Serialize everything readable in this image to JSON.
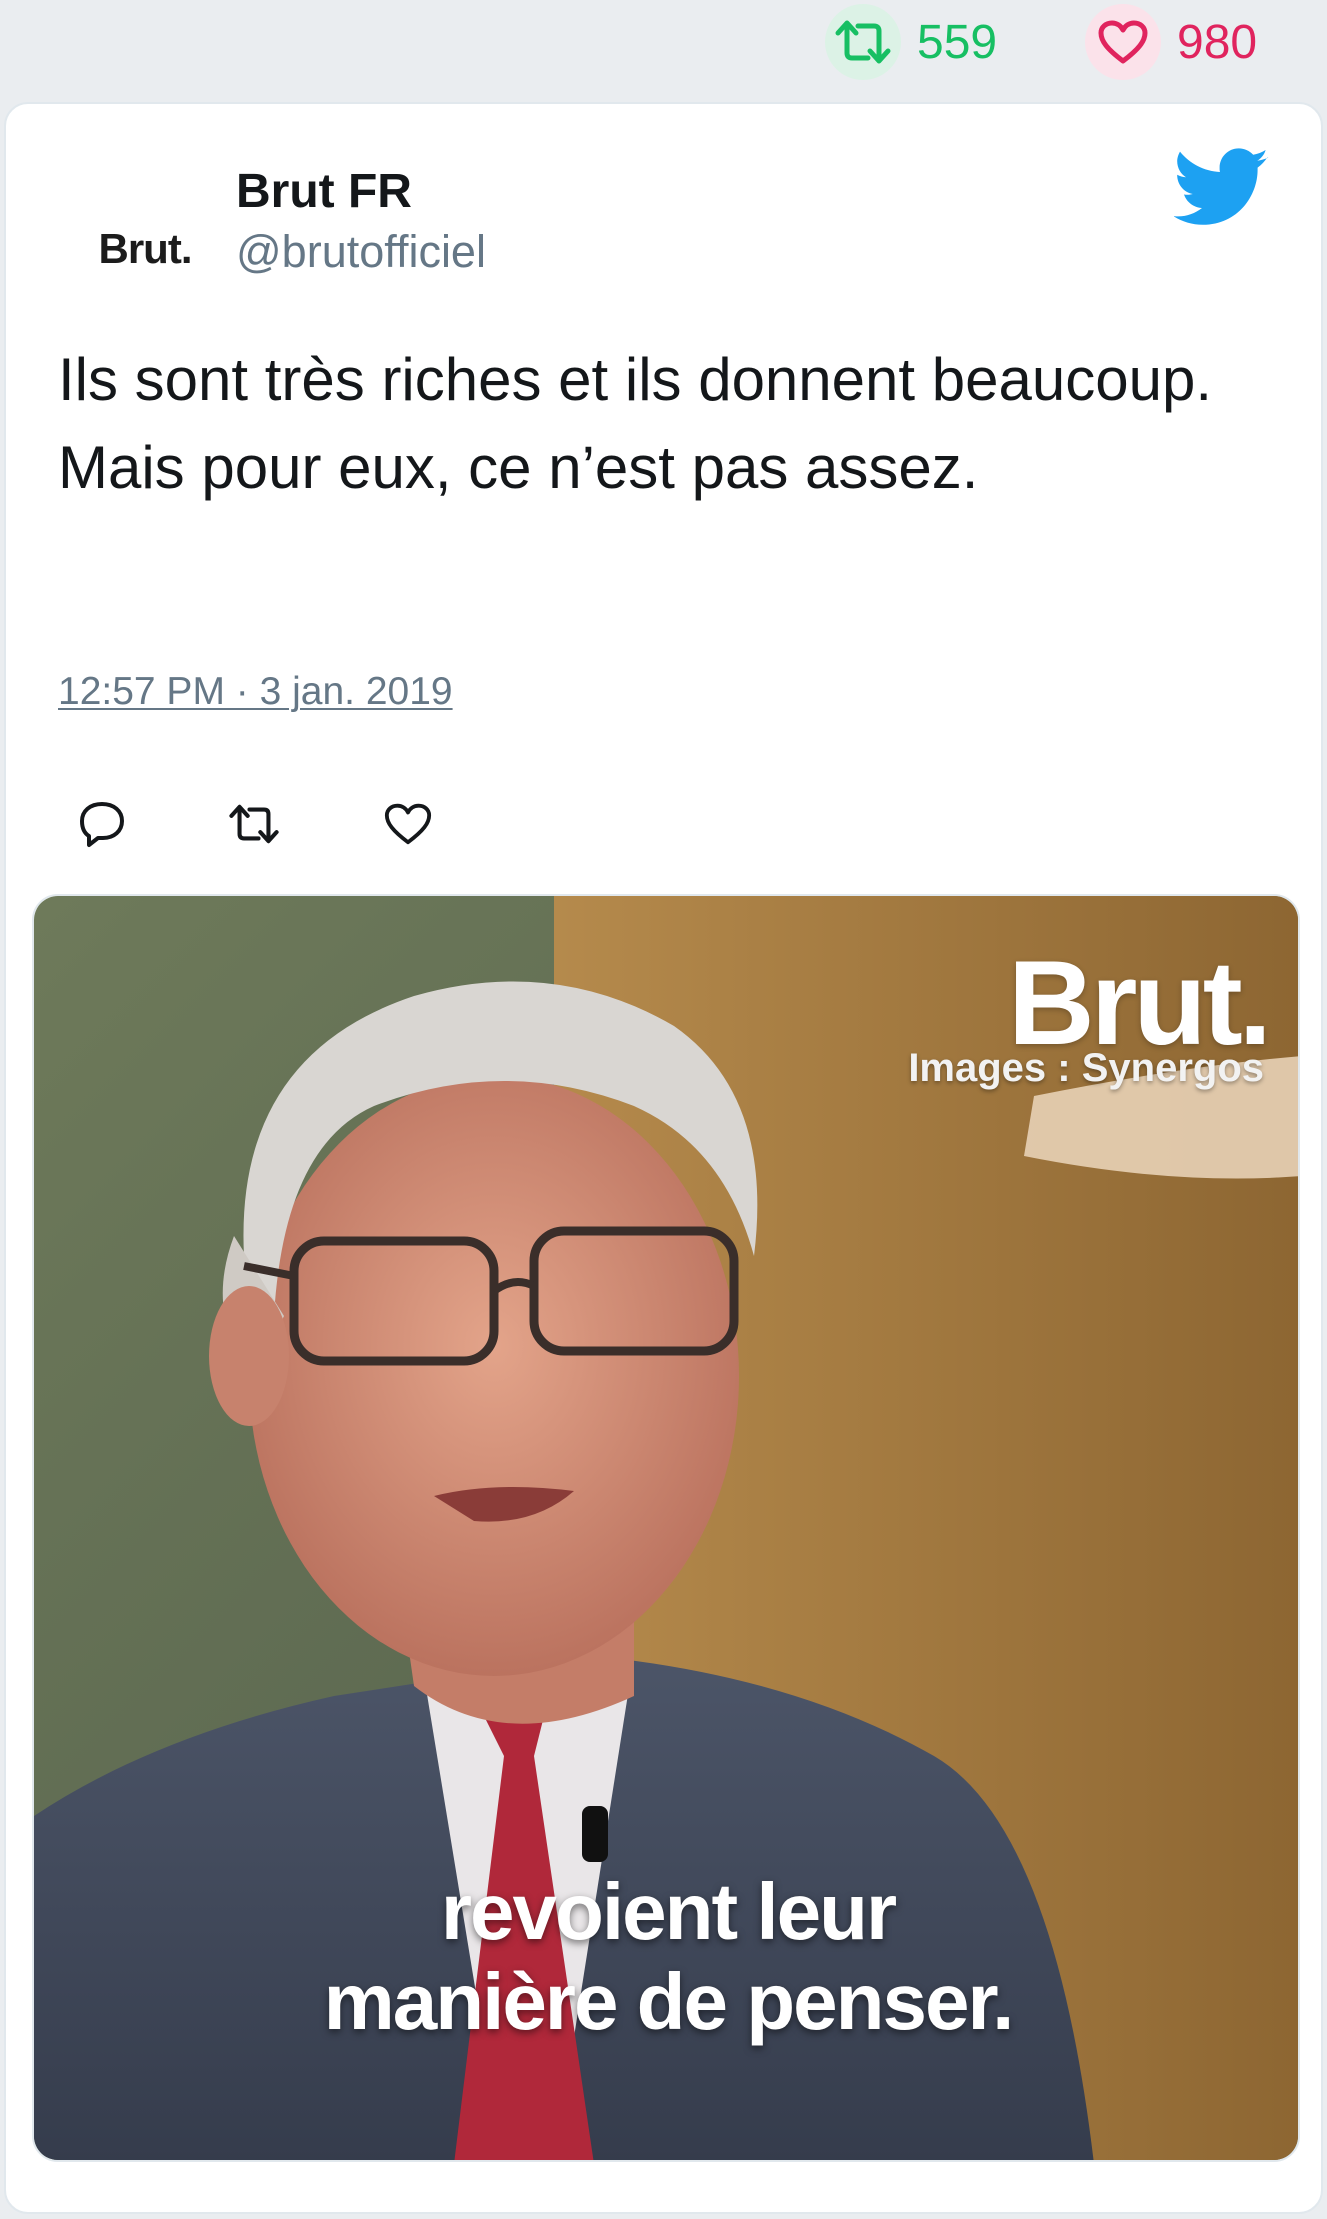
{
  "stats": {
    "retweet_count": "559",
    "like_count": "980",
    "retweet_color": "#17bf63",
    "like_color": "#e0245e"
  },
  "tweet": {
    "avatar_text": "Brut.",
    "display_name": "Brut FR",
    "handle": "@brutofficiel",
    "text": "Ils sont très riches et ils donnent beaucoup. Mais pour eux, ce n’est pas assez.",
    "timestamp": "12:57 PM · 3 jan. 2019",
    "icons": {
      "platform": "twitter-bird-icon",
      "reply": "reply-icon",
      "retweet": "retweet-icon",
      "like": "heart-icon"
    },
    "brand_color": "#1da1f2"
  },
  "media": {
    "logo": "Brut.",
    "credit": "Images : Synergos",
    "subtitle_line1": "revoient leur",
    "subtitle_line2": "manière de penser."
  }
}
